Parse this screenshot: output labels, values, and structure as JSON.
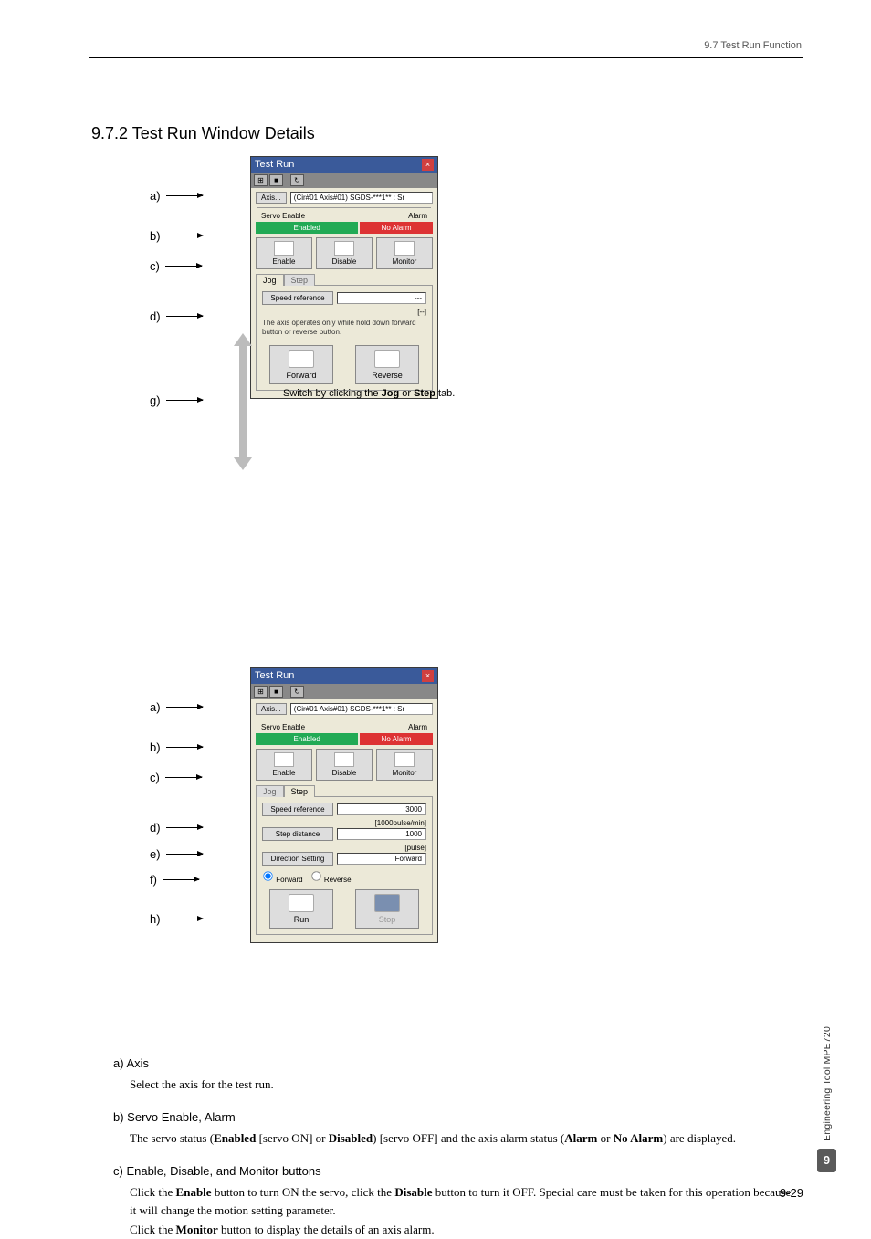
{
  "header": {
    "breadcrumb": "9.7  Test Run Function"
  },
  "h2": "9.7.2  Test Run Window Details",
  "callouts": {
    "a": "a)",
    "b": "b)",
    "c": "c)",
    "d": "d)",
    "e": "e)",
    "f": "f)",
    "g": "g)",
    "h": "h)"
  },
  "switch_text_pre": "Switch by clicking the ",
  "switch_text_jog": "Jog",
  "switch_text_or": " or ",
  "switch_text_step": "Step",
  "switch_text_post": " tab.",
  "win1": {
    "title": "Test Run",
    "toolbar": {
      "b1": "⊞",
      "b2": "■",
      "b3": "↻"
    },
    "axis_btn": "Axis...",
    "axis_val": "(Cir#01 Axis#01) SGDS-***1** : Sr",
    "labels": {
      "servo_enable": "Servo Enable",
      "alarm": "Alarm"
    },
    "pills": {
      "enabled": "Enabled",
      "no_alarm": "No Alarm"
    },
    "big": {
      "enable": "Enable",
      "disable": "Disable",
      "monitor": "Monitor"
    },
    "tabs": {
      "jog": "Jog",
      "step": "Step"
    },
    "jog": {
      "speed_btn": "Speed reference",
      "speed_val": "---",
      "unit": "[--]",
      "note": "The axis operates only while hold down forward button or reverse button.",
      "forward": "Forward",
      "reverse": "Reverse"
    }
  },
  "win2": {
    "title": "Test Run",
    "toolbar": {
      "b1": "⊞",
      "b2": "■",
      "b3": "↻"
    },
    "axis_btn": "Axis...",
    "axis_val": "(Cir#01 Axis#01) SGDS-***1** : Sr",
    "labels": {
      "servo_enable": "Servo Enable",
      "alarm": "Alarm"
    },
    "pills": {
      "enabled": "Enabled",
      "no_alarm": "No Alarm"
    },
    "big": {
      "enable": "Enable",
      "disable": "Disable",
      "monitor": "Monitor"
    },
    "tabs": {
      "jog": "Jog",
      "step": "Step"
    },
    "step": {
      "speed_btn": "Speed reference",
      "speed_val": "3000",
      "speed_unit": "[1000pulse/min]",
      "dist_btn": "Step distance",
      "dist_val": "1000",
      "dist_unit": "[pulse]",
      "dir_btn": "Direction Setting",
      "dir_val": "Forward",
      "radio_fwd": "Forward",
      "radio_rev": "Reverse",
      "run": "Run",
      "stop": "Stop"
    }
  },
  "desc": {
    "a_h": "a) Axis",
    "a_p": "Select the axis for the test run.",
    "b_h": "b) Servo Enable, Alarm",
    "b_p1": "The servo status (",
    "b_p1b": "Enabled",
    "b_p2": " [servo ON] or ",
    "b_p2b": "Disabled",
    "b_p3": ") [servo OFF] and the axis alarm status (",
    "b_p3b": "Alarm",
    "b_p4": " or ",
    "b_p4b": "No Alarm",
    "b_p5": ") are displayed.",
    "c_h": "c) Enable, Disable, and Monitor buttons",
    "c_p1": "Click the ",
    "c_p1b": "Enable",
    "c_p2": " button to turn ON the servo, click the ",
    "c_p2b": "Disable",
    "c_p3": " button to turn it OFF. Special care must be taken for this operation because it will change the motion setting parameter.",
    "c_p4": "Click the ",
    "c_p4b": "Monitor",
    "c_p5": " button to display the details of an axis alarm."
  },
  "side": {
    "label": "Engineering Tool MPE720",
    "chapter": "9"
  },
  "page_num": "9-29"
}
